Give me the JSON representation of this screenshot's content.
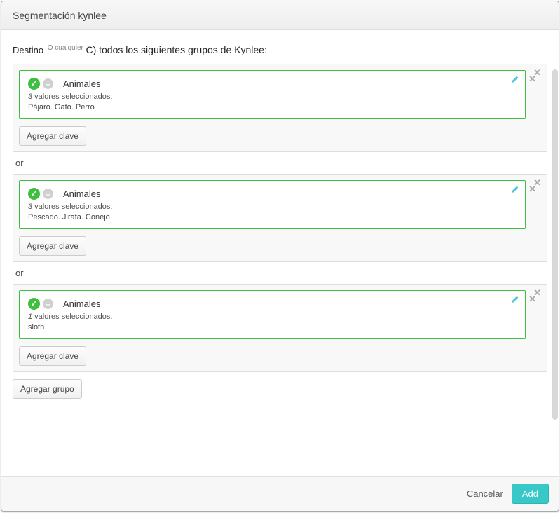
{
  "header": {
    "title": "Segmentación kynlee"
  },
  "destino": {
    "label": "Destino",
    "superscript": "O cualquier",
    "rest": "C) todos los siguientes grupos de Kynlee:"
  },
  "separator": "or",
  "groups": [
    {
      "key_name": "Animales",
      "count": "3",
      "count_suffix": " valores seleccionados:",
      "values": "Pájaro. Gato. Perro"
    },
    {
      "key_name": "Animales",
      "count": "3",
      "count_suffix": " valores seleccionados:",
      "values": "Pescado. Jirafa. Conejo"
    },
    {
      "key_name": "Animales",
      "count": "1",
      "count_suffix": " valores seleccionados:",
      "values": "sloth"
    }
  ],
  "buttons": {
    "add_key": "Agregar clave",
    "add_group": "Agregar grupo",
    "cancel": "Cancelar",
    "add": "Add"
  }
}
